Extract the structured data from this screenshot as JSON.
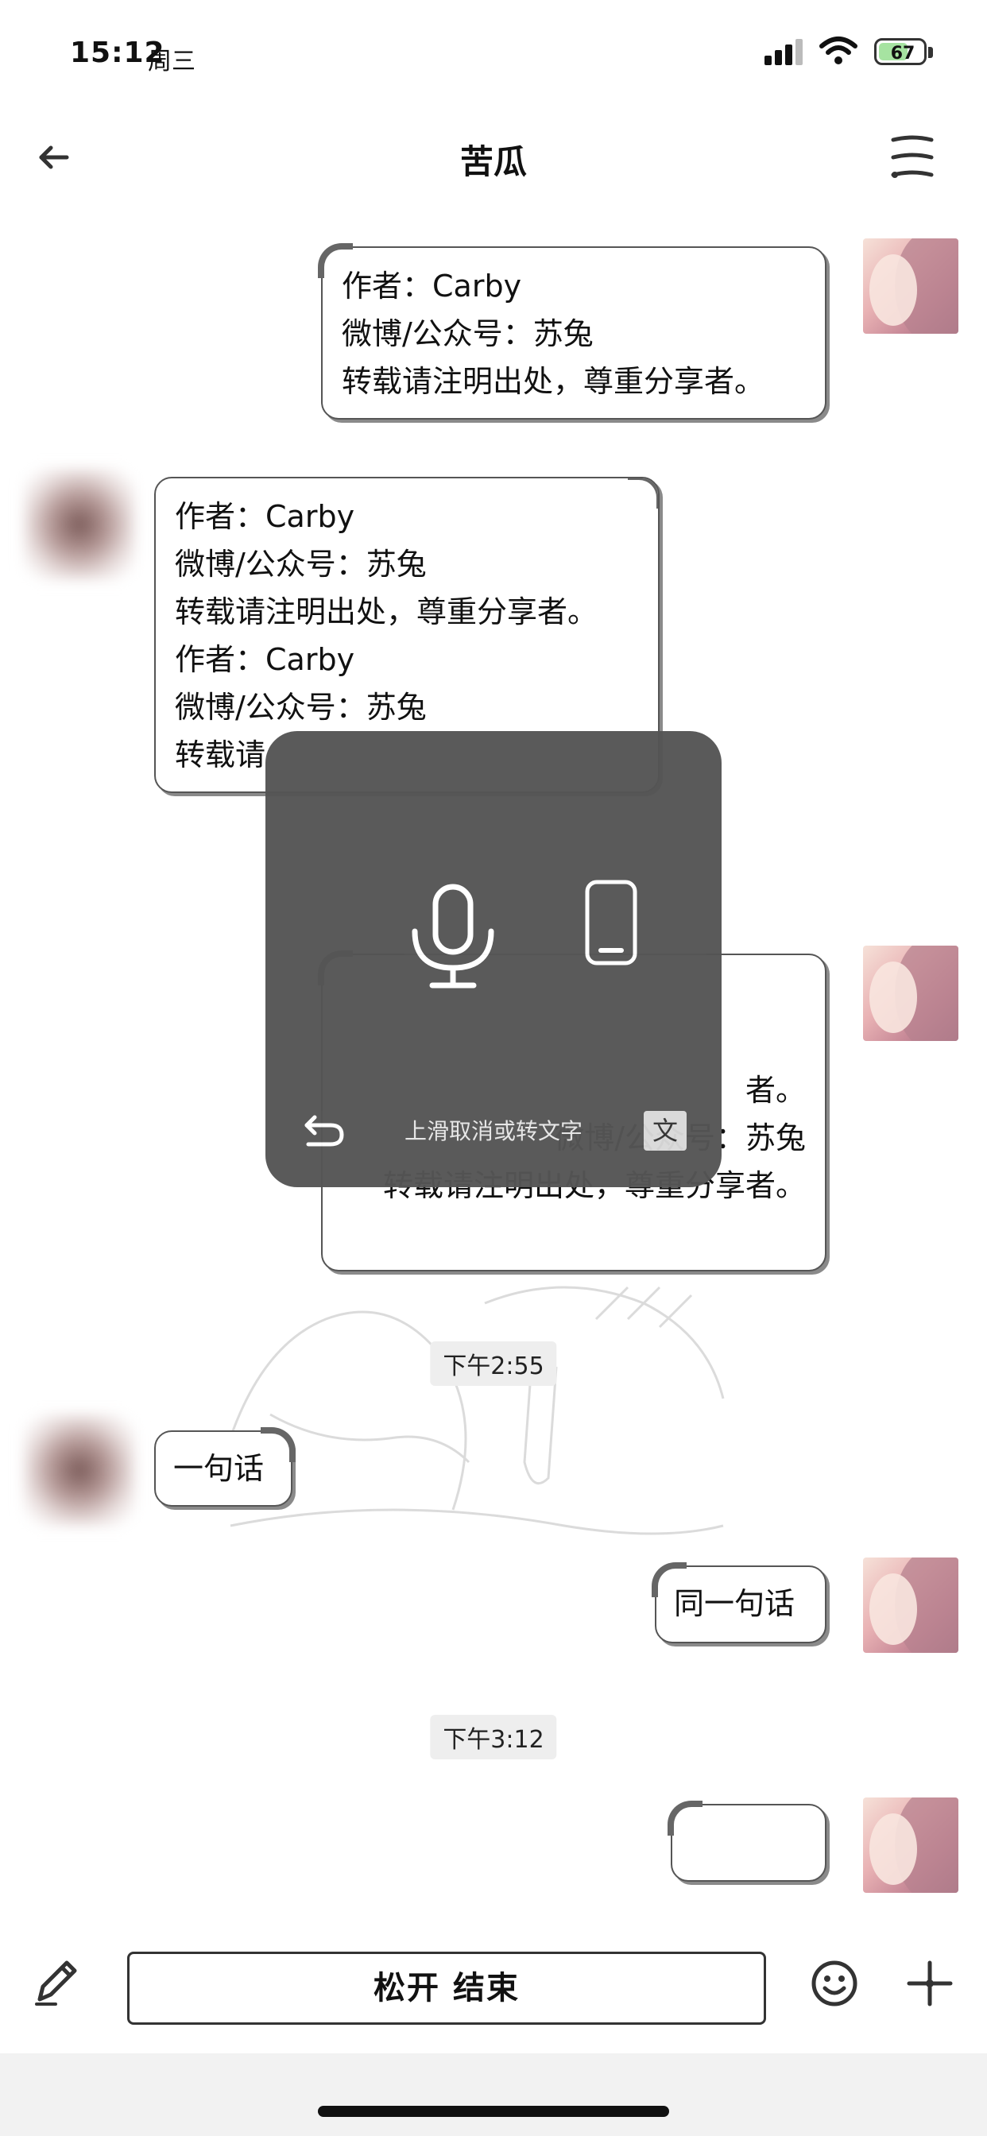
{
  "status_bar": {
    "time": "15:12",
    "weekday": "周三",
    "battery": "67",
    "battery_level": 0.67,
    "battery_color": "#a6e3a1"
  },
  "nav": {
    "back_icon": "arrow-left-icon",
    "title": "苦瓜",
    "menu_icon": "menu-icon"
  },
  "messages": [
    {
      "side": "right",
      "text": "作者：Carby\n微博/公众号：苏兔\n转载请注明出处，尊重分享者。"
    },
    {
      "side": "left",
      "text": "作者：Carby\n微博/公众号：苏兔\n转载请注明出处，尊重分享者。\n作者：Carby\n微博/公众号：苏兔\n转载请"
    },
    {
      "side": "right",
      "text": "者。\n微博/公众号：苏兔\n转载请注明出处，尊重分享者。"
    },
    {
      "side": "left",
      "text": "一句话"
    },
    {
      "side": "right",
      "text": "同一句话"
    },
    {
      "side": "right",
      "text": ""
    }
  ],
  "time_dividers": [
    "下午2:55",
    "下午3:12"
  ],
  "voice_overlay": {
    "mic_icon": "microphone-icon",
    "phone_icon": "phone-icon",
    "undo_icon": "undo-icon",
    "hint": "上滑取消或转文字",
    "to_text_label": "文"
  },
  "input_bar": {
    "pencil_icon": "pencil-icon",
    "hold_button_label": "松开 结束",
    "emoji_icon": "emoji-icon",
    "plus_icon": "plus-icon"
  }
}
